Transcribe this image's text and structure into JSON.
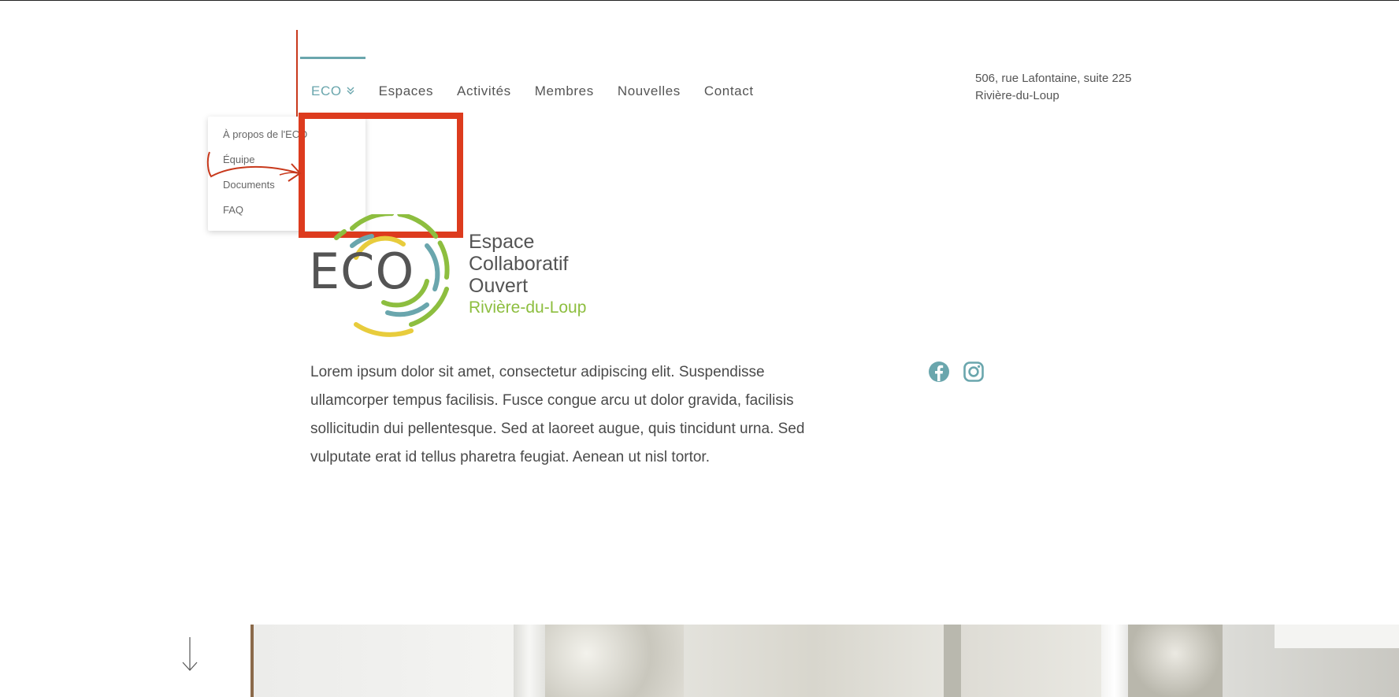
{
  "nav": {
    "items": [
      {
        "label": "ECO",
        "active": true
      },
      {
        "label": "Espaces"
      },
      {
        "label": "Activités"
      },
      {
        "label": "Membres"
      },
      {
        "label": "Nouvelles"
      },
      {
        "label": "Contact"
      }
    ]
  },
  "dropdown": {
    "items": [
      "À propos de l'ECO",
      "Équipe",
      "Documents",
      "FAQ"
    ]
  },
  "address": {
    "line1": "506, rue Lafontaine, suite 225",
    "line2": "Rivière-du-Loup"
  },
  "logo": {
    "acronym": "ECO",
    "line1": "Espace",
    "line2": "Collaboratif",
    "line3": "Ouvert",
    "city": "Rivière-du-Loup"
  },
  "body": {
    "text": "Lorem ipsum dolor sit amet, consectetur adipiscing elit. Suspendisse ullamcorper tempus facilisis. Fusce congue arcu ut dolor gravida, facilisis sollicitudin dui pellentesque. Sed at laoreet augue, quis tincidunt urna. Sed vulputate erat id tellus pharetra feugiat. Aenean ut nisl tortor."
  },
  "social": {
    "icons": [
      "facebook-icon",
      "instagram-icon"
    ]
  },
  "colors": {
    "accent": "#6aa6ad",
    "green": "#8dbe3f",
    "yellow": "#e8cc3c",
    "annotation_red": "#dd3b1e",
    "text": "#4a4a4a"
  }
}
